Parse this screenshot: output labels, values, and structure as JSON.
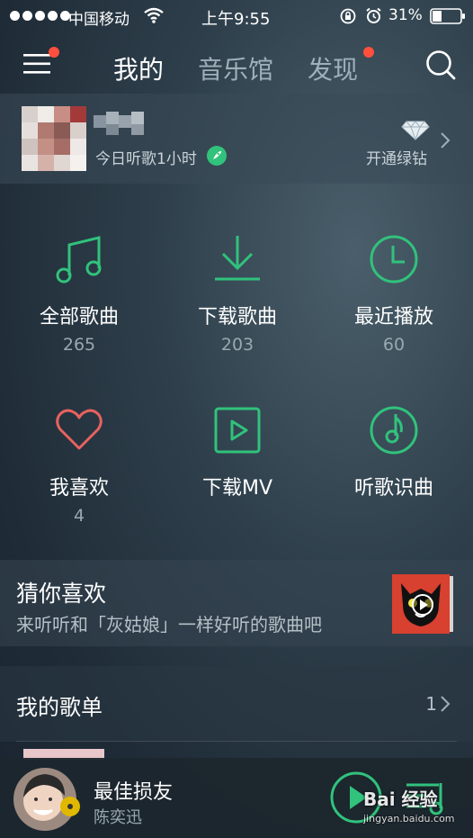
{
  "status_bar": {
    "carrier": "中国移动",
    "time": "上午9:55",
    "battery": "31%"
  },
  "header": {
    "tabs": [
      {
        "label": "我的",
        "active": true
      },
      {
        "label": "音乐馆",
        "active": false
      },
      {
        "label": "发现",
        "active": false,
        "badge": true
      }
    ],
    "menu_badge": true
  },
  "user": {
    "listen_time": "今日听歌1小时",
    "vip_label": "开通绿钻"
  },
  "grid": [
    {
      "label": "全部歌曲",
      "count": "265",
      "icon": "music-note-icon"
    },
    {
      "label": "下载歌曲",
      "count": "203",
      "icon": "download-icon"
    },
    {
      "label": "最近播放",
      "count": "60",
      "icon": "clock-icon"
    },
    {
      "label": "我喜欢",
      "count": "4",
      "icon": "heart-icon"
    },
    {
      "label": "下载MV",
      "count": "",
      "icon": "mv-play-icon"
    },
    {
      "label": "听歌识曲",
      "count": "",
      "icon": "recognize-music-icon"
    }
  ],
  "recommend": {
    "title": "猜你喜欢",
    "subtitle": "来听听和「灰姑娘」一样好听的歌曲吧"
  },
  "playlist": {
    "title": "我的歌单",
    "count": "1"
  },
  "player": {
    "song": "最佳损友",
    "artist": "陈奕迅"
  },
  "watermark": {
    "text": "Bai 经验",
    "url": "jingyan.baidu.com"
  },
  "colors": {
    "accent": "#31c27c",
    "badge": "#ff4f3d",
    "heart": "#e8625f"
  }
}
